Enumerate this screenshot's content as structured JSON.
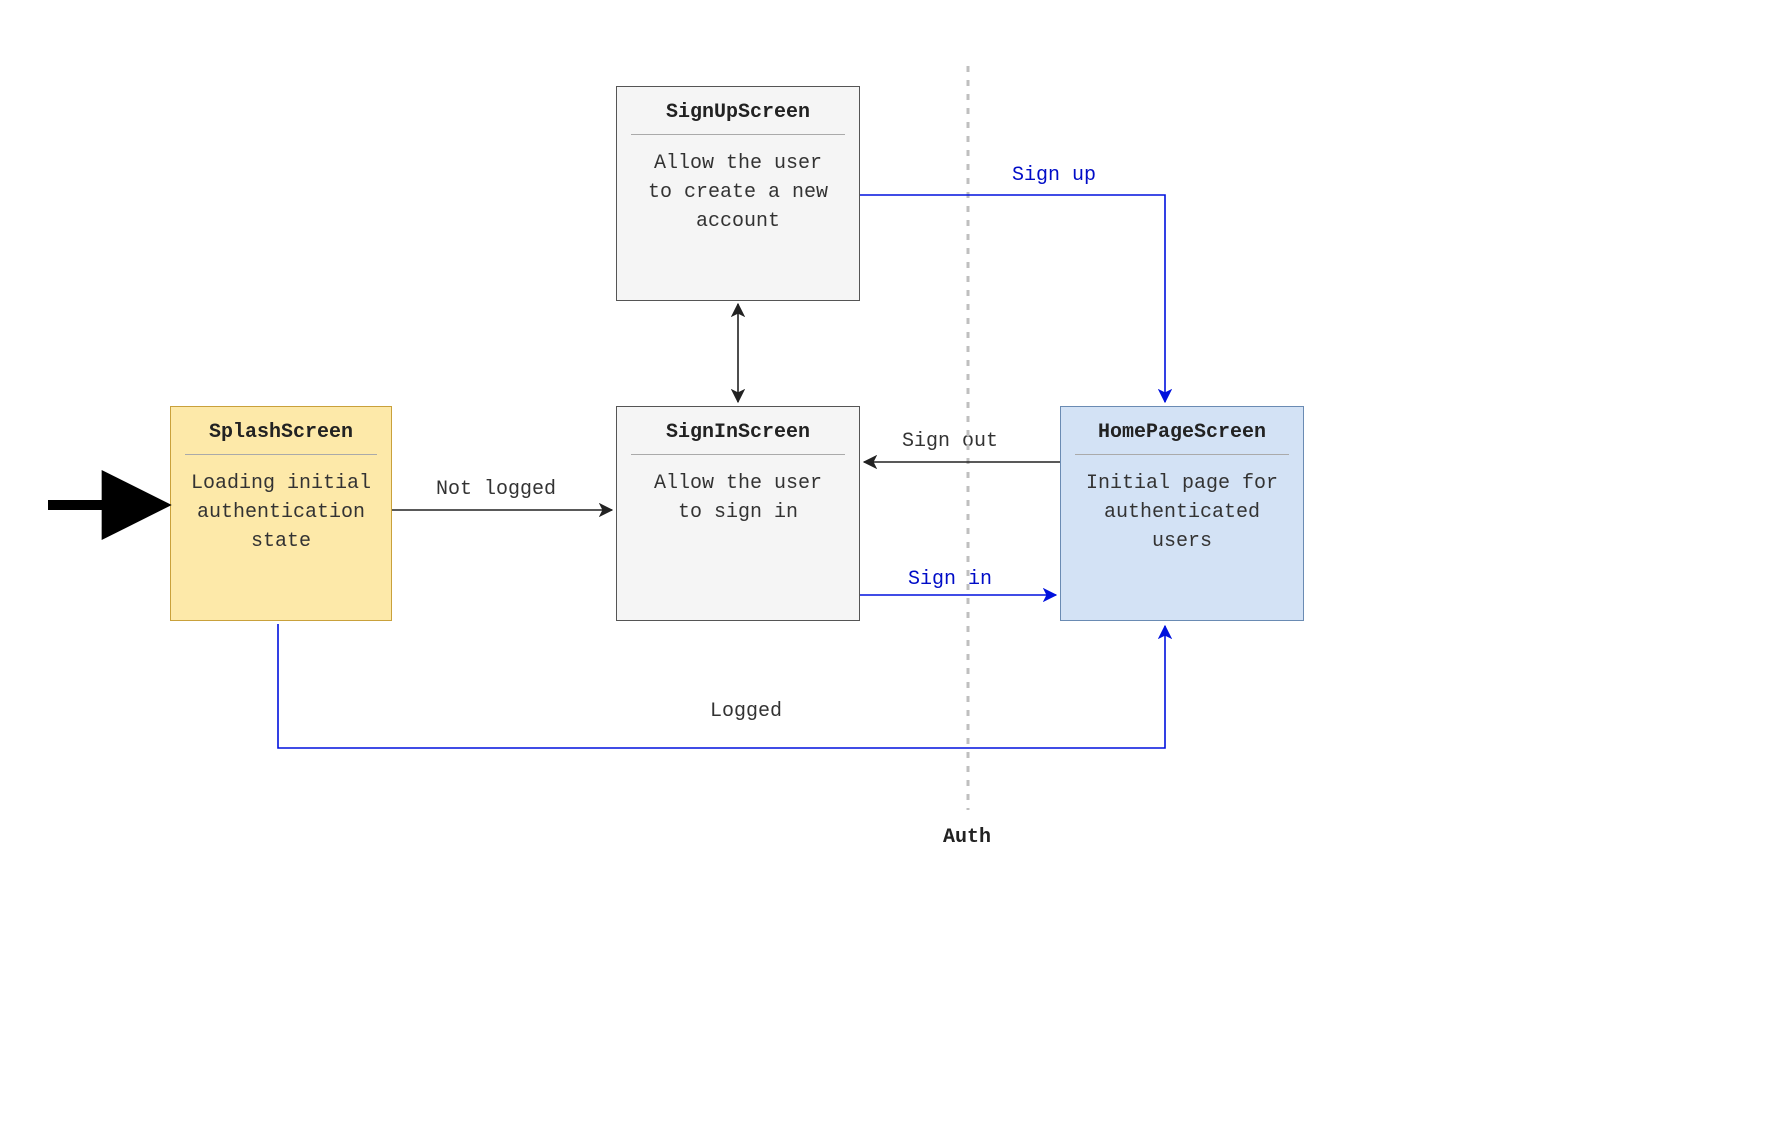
{
  "nodes": {
    "splash": {
      "title": "SplashScreen",
      "desc": "Loading initial\nauthentication\nstate"
    },
    "signup": {
      "title": "SignUpScreen",
      "desc": "Allow the user\nto create a new\naccount"
    },
    "signin": {
      "title": "SignInScreen",
      "desc": "Allow the user\nto sign in"
    },
    "home": {
      "title": "HomePageScreen",
      "desc": "Initial page for\nauthenticated\nusers"
    }
  },
  "edges": {
    "not_logged": "Not logged",
    "logged": "Logged",
    "sign_in": "Sign in",
    "sign_out": "Sign out",
    "sign_up": "Sign up"
  },
  "section": {
    "auth": "Auth"
  },
  "colors": {
    "edge_black": "#222222",
    "edge_blue": "#0011dd",
    "entry_arrow": "#000000"
  }
}
